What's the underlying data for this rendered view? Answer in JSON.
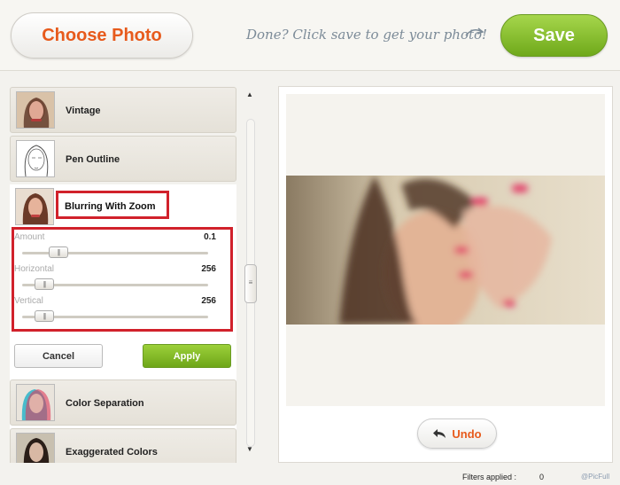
{
  "header": {
    "choose_photo_label": "Choose Photo",
    "hint_text": "Done? Click save to get your photo!",
    "save_label": "Save"
  },
  "filters": {
    "items": [
      {
        "label": "Vintage",
        "icon": "vintage-thumbnail"
      },
      {
        "label": "Pen Outline",
        "icon": "pen-outline-thumbnail"
      },
      {
        "label": "Blurring With Zoom",
        "icon": "blur-zoom-thumbnail"
      },
      {
        "label": "Color Separation",
        "icon": "color-separation-thumbnail"
      },
      {
        "label": "Exaggerated Colors",
        "icon": "exaggerated-colors-thumbnail"
      }
    ],
    "active": {
      "params": [
        {
          "label": "Amount",
          "value": "0.1",
          "level": 0.1
        },
        {
          "label": "Horizontal",
          "value": "256",
          "level": 0.05
        },
        {
          "label": "Vertical",
          "value": "256",
          "level": 0.05
        }
      ],
      "cancel_label": "Cancel",
      "apply_label": "Apply"
    }
  },
  "preview": {
    "undo_label": "Undo"
  },
  "footer": {
    "filters_applied_label": "Filters applied :",
    "filters_applied_count": "0",
    "brand": "@PicFull"
  },
  "colors": {
    "accent_orange": "#e75a1c",
    "save_green": "#7fbf22",
    "highlight_red": "#d1212b"
  }
}
